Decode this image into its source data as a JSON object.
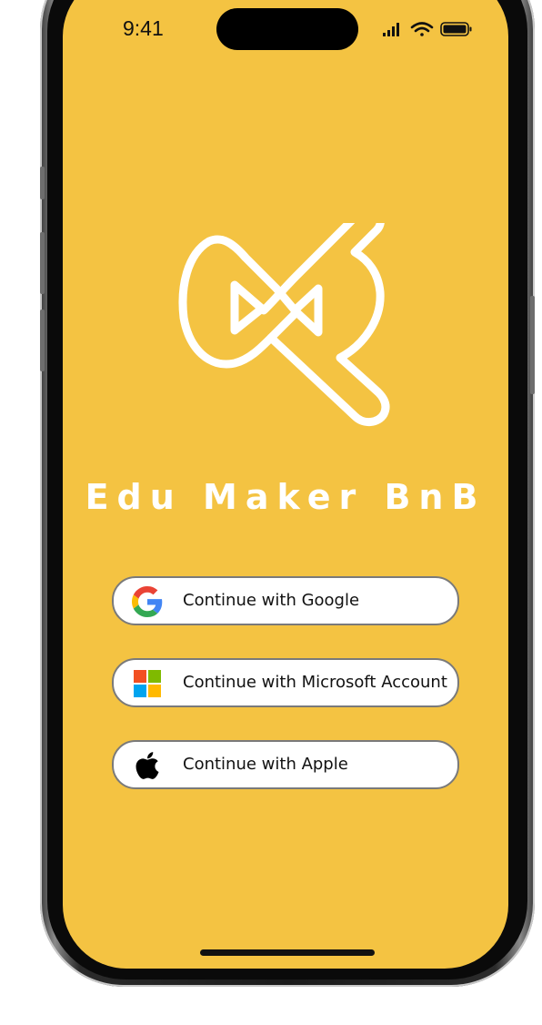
{
  "status_bar": {
    "time": "9:41",
    "icons": [
      "signal-icon",
      "wifi-icon",
      "battery-icon"
    ]
  },
  "app": {
    "title": "Edu Maker BnB",
    "logo": "bow-tie-play-logo"
  },
  "login": {
    "buttons": [
      {
        "label": "Continue with Google",
        "icon": "google-icon"
      },
      {
        "label": "Continue with Microsoft Account",
        "icon": "microsoft-icon"
      },
      {
        "label": "Continue with Apple",
        "icon": "apple-icon"
      }
    ]
  },
  "colors": {
    "screen_background": "#f4c342",
    "title_text": "#ffffff",
    "button_background": "#ffffff",
    "button_border": "#7a7a7a",
    "google_blue": "#4285F4",
    "google_red": "#EA4335",
    "google_yellow": "#FBBC05",
    "google_green": "#34A853",
    "ms_red": "#F25022",
    "ms_green": "#7FBA00",
    "ms_blue": "#00A4EF",
    "ms_yellow": "#FFB900"
  }
}
